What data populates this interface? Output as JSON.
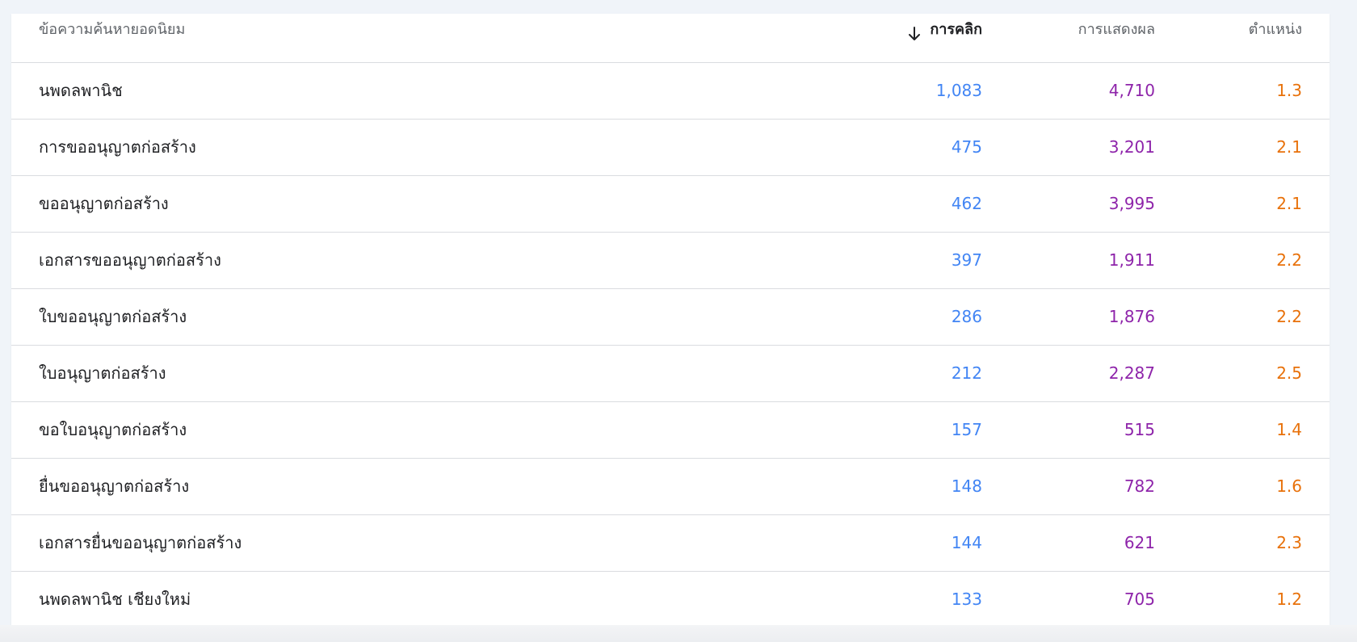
{
  "colors": {
    "clicks": "#4285f4",
    "impressions": "#8e24aa",
    "position": "#e8710a",
    "text": "#202124",
    "header_text": "#5f6368"
  },
  "table": {
    "headers": {
      "query": "ข้อความค้นหายอดนิยม",
      "clicks": "การคลิก",
      "clicks_sort_icon": "arrow-down-icon",
      "impressions": "การแสดงผล",
      "position": "ตำแหน่ง"
    },
    "rows": [
      {
        "query": "นพดลพานิช",
        "clicks": "1,083",
        "impressions": "4,710",
        "position": "1.3"
      },
      {
        "query": "การขออนุญาตก่อสร้าง",
        "clicks": "475",
        "impressions": "3,201",
        "position": "2.1"
      },
      {
        "query": "ขออนุญาตก่อสร้าง",
        "clicks": "462",
        "impressions": "3,995",
        "position": "2.1"
      },
      {
        "query": "เอกสารขออนุญาตก่อสร้าง",
        "clicks": "397",
        "impressions": "1,911",
        "position": "2.2"
      },
      {
        "query": "ใบขออนุญาตก่อสร้าง",
        "clicks": "286",
        "impressions": "1,876",
        "position": "2.2"
      },
      {
        "query": "ใบอนุญาตก่อสร้าง",
        "clicks": "212",
        "impressions": "2,287",
        "position": "2.5"
      },
      {
        "query": "ขอใบอนุญาตก่อสร้าง",
        "clicks": "157",
        "impressions": "515",
        "position": "1.4"
      },
      {
        "query": "ยื่นขออนุญาตก่อสร้าง",
        "clicks": "148",
        "impressions": "782",
        "position": "1.6"
      },
      {
        "query": "เอกสารยื่นขออนุญาตก่อสร้าง",
        "clicks": "144",
        "impressions": "621",
        "position": "2.3"
      },
      {
        "query": "นพดลพานิช เชียงใหม่",
        "clicks": "133",
        "impressions": "705",
        "position": "1.2"
      }
    ]
  }
}
